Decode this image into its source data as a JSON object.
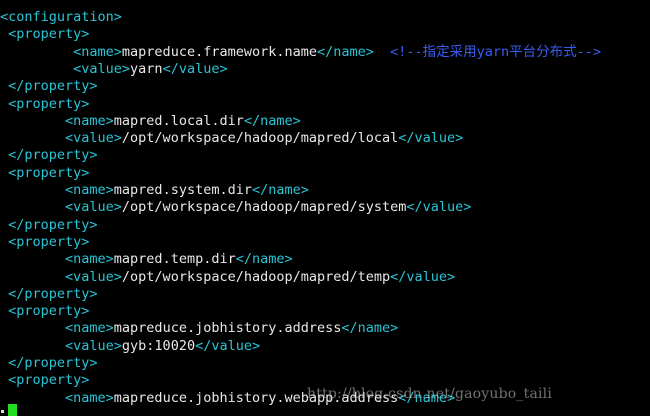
{
  "colors": {
    "background": "#000000",
    "tag": "#29c5d6",
    "text": "#e8e8e8",
    "comment": "#3a5cf0",
    "cursor": "#22dd22"
  },
  "lines": [
    {
      "segments": [
        {
          "t": "<configuration>",
          "k": "tag"
        }
      ]
    },
    {
      "segments": [
        {
          "t": " <property>",
          "k": "tag"
        }
      ]
    },
    {
      "segments": [
        {
          "t": "         <name>",
          "k": "tag"
        },
        {
          "t": "mapreduce.framework.name",
          "k": "txt"
        },
        {
          "t": "</name>",
          "k": "tag"
        },
        {
          "t": "  <!--指定采用yarn平台分布式-->",
          "k": "comment"
        }
      ]
    },
    {
      "segments": [
        {
          "t": "         <value>",
          "k": "tag"
        },
        {
          "t": "yarn",
          "k": "txt"
        },
        {
          "t": "</value>",
          "k": "tag"
        }
      ]
    },
    {
      "segments": [
        {
          "t": " </property>",
          "k": "tag"
        }
      ]
    },
    {
      "segments": [
        {
          "t": " <property>",
          "k": "tag"
        }
      ]
    },
    {
      "segments": [
        {
          "t": "        <name>",
          "k": "tag"
        },
        {
          "t": "mapred.local.dir",
          "k": "txt"
        },
        {
          "t": "</name>",
          "k": "tag"
        }
      ]
    },
    {
      "segments": [
        {
          "t": "        <value>",
          "k": "tag"
        },
        {
          "t": "/opt/workspace/hadoop/mapred/local",
          "k": "txt"
        },
        {
          "t": "</value>",
          "k": "tag"
        }
      ]
    },
    {
      "segments": [
        {
          "t": " </property>",
          "k": "tag"
        }
      ]
    },
    {
      "segments": [
        {
          "t": " <property>",
          "k": "tag"
        }
      ]
    },
    {
      "segments": [
        {
          "t": "        <name>",
          "k": "tag"
        },
        {
          "t": "mapred.system.dir",
          "k": "txt"
        },
        {
          "t": "</name>",
          "k": "tag"
        }
      ]
    },
    {
      "segments": [
        {
          "t": "        <value>",
          "k": "tag"
        },
        {
          "t": "/opt/workspace/hadoop/mapred/system",
          "k": "txt"
        },
        {
          "t": "</value>",
          "k": "tag"
        }
      ]
    },
    {
      "segments": [
        {
          "t": " </property>",
          "k": "tag"
        }
      ]
    },
    {
      "segments": [
        {
          "t": " <property>",
          "k": "tag"
        }
      ]
    },
    {
      "segments": [
        {
          "t": "        <name>",
          "k": "tag"
        },
        {
          "t": "mapred.temp.dir",
          "k": "txt"
        },
        {
          "t": "</name>",
          "k": "tag"
        }
      ]
    },
    {
      "segments": [
        {
          "t": "        <value>",
          "k": "tag"
        },
        {
          "t": "/opt/workspace/hadoop/mapred/temp",
          "k": "txt"
        },
        {
          "t": "</value>",
          "k": "tag"
        }
      ]
    },
    {
      "segments": [
        {
          "t": " </property>",
          "k": "tag"
        }
      ]
    },
    {
      "segments": [
        {
          "t": " <property>",
          "k": "tag"
        }
      ]
    },
    {
      "segments": [
        {
          "t": "        <name>",
          "k": "tag"
        },
        {
          "t": "mapreduce.jobhistory.address",
          "k": "txt"
        },
        {
          "t": "</name>",
          "k": "tag"
        }
      ]
    },
    {
      "segments": [
        {
          "t": "        <value>",
          "k": "tag"
        },
        {
          "t": "gyb:10020",
          "k": "txt"
        },
        {
          "t": "</value>",
          "k": "tag"
        }
      ]
    },
    {
      "segments": [
        {
          "t": " </property>",
          "k": "tag"
        }
      ]
    },
    {
      "segments": [
        {
          "t": " <property>",
          "k": "tag"
        }
      ]
    },
    {
      "segments": [
        {
          "t": "        <name>",
          "k": "tag"
        },
        {
          "t": "mapreduce.jobhistory.webapp.address",
          "k": "txt"
        },
        {
          "t": "</name>",
          "k": "tag"
        }
      ]
    }
  ],
  "watermark": "http://blog.csdn.net/gaoyubo_taili"
}
